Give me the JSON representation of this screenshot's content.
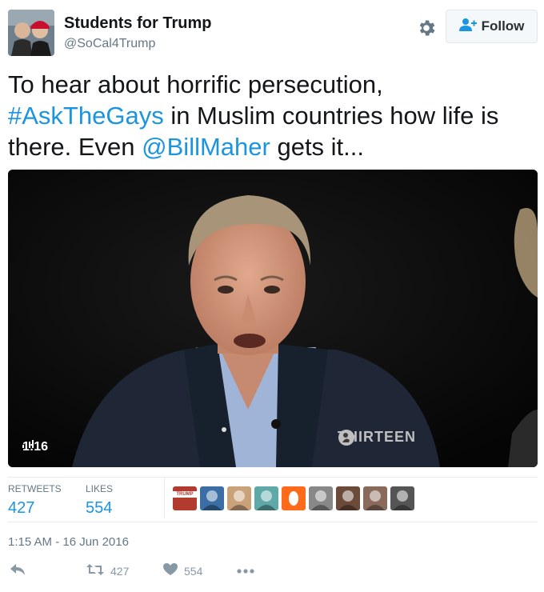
{
  "account": {
    "name": "Students for Trump",
    "handle": "@SoCal4Trump",
    "follow_label": "Follow",
    "avatar_cap_text": ""
  },
  "tweet": {
    "segments": [
      {
        "text": "To hear about horrific persecution, ",
        "link": false
      },
      {
        "text": "#AskTheGays",
        "link": true
      },
      {
        "text": " in Muslim countries how life is there. Even ",
        "link": false
      },
      {
        "text": "@BillMaher",
        "link": true
      },
      {
        "text": " gets it...",
        "link": false
      }
    ]
  },
  "media": {
    "duration": "1:16",
    "watermark": "THIRTEEN"
  },
  "stats": {
    "retweets_label": "RETWEETS",
    "retweets_value": "427",
    "likes_label": "LIKES",
    "likes_value": "554"
  },
  "likers": [
    {
      "icon": "trump-sign-avatar",
      "color": "#b33a2e",
      "text": "TRUMP"
    },
    {
      "icon": "flag-avatar",
      "color": "#3a6ea5"
    },
    {
      "icon": "woman-avatar",
      "color": "#c9a27a"
    },
    {
      "icon": "cartoon-avatar",
      "color": "#5fa8a8"
    },
    {
      "icon": "orange-logo-avatar",
      "color": "#ff6b1a"
    },
    {
      "icon": "bw-photo-avatar",
      "color": "#888888"
    },
    {
      "icon": "portrait-avatar",
      "color": "#6b4a3a"
    },
    {
      "icon": "group-avatar",
      "color": "#8a6a5a"
    },
    {
      "icon": "bearded-man-avatar",
      "color": "#555555"
    }
  ],
  "timestamp": "1:15 AM - 16 Jun 2016",
  "actions": {
    "retweet_count": "427",
    "like_count": "554"
  },
  "colors": {
    "link": "#1b95e0",
    "muted": "#657786",
    "action": "#8899a6"
  }
}
